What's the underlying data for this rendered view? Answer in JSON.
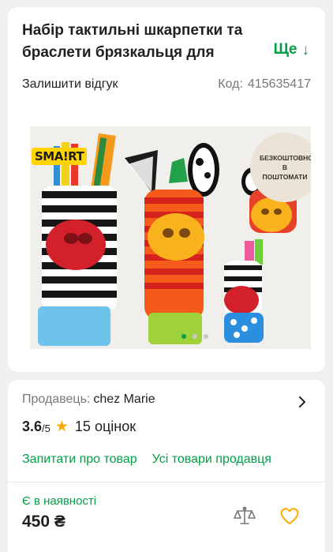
{
  "product": {
    "title": "Набір тактильні шкарпетки та браслети брязкальця для",
    "more_label": "Ще",
    "more_arrow": "↓",
    "review_link": "Залишити відгук",
    "code_label": "Код:",
    "code_value": "415635417"
  },
  "gallery": {
    "logo_text": "SMA!RT",
    "badge_text": "БЕЗКОШТОВНО В ПОШТОМАТИ",
    "dots_count": 3,
    "active_dot": 0
  },
  "seller": {
    "label": "Продавець:",
    "name": "chez Marie",
    "rating": "3.6",
    "rating_max": "/5",
    "reviews": "15 оцінок",
    "ask_link": "Запитати про товар",
    "all_link": "Усі товари продавця"
  },
  "purchase": {
    "stock_status": "Є в наявності",
    "price": "450 ₴"
  },
  "colors": {
    "accent_green": "#00a046",
    "star": "#ffa900",
    "heart": "#ffa900"
  }
}
